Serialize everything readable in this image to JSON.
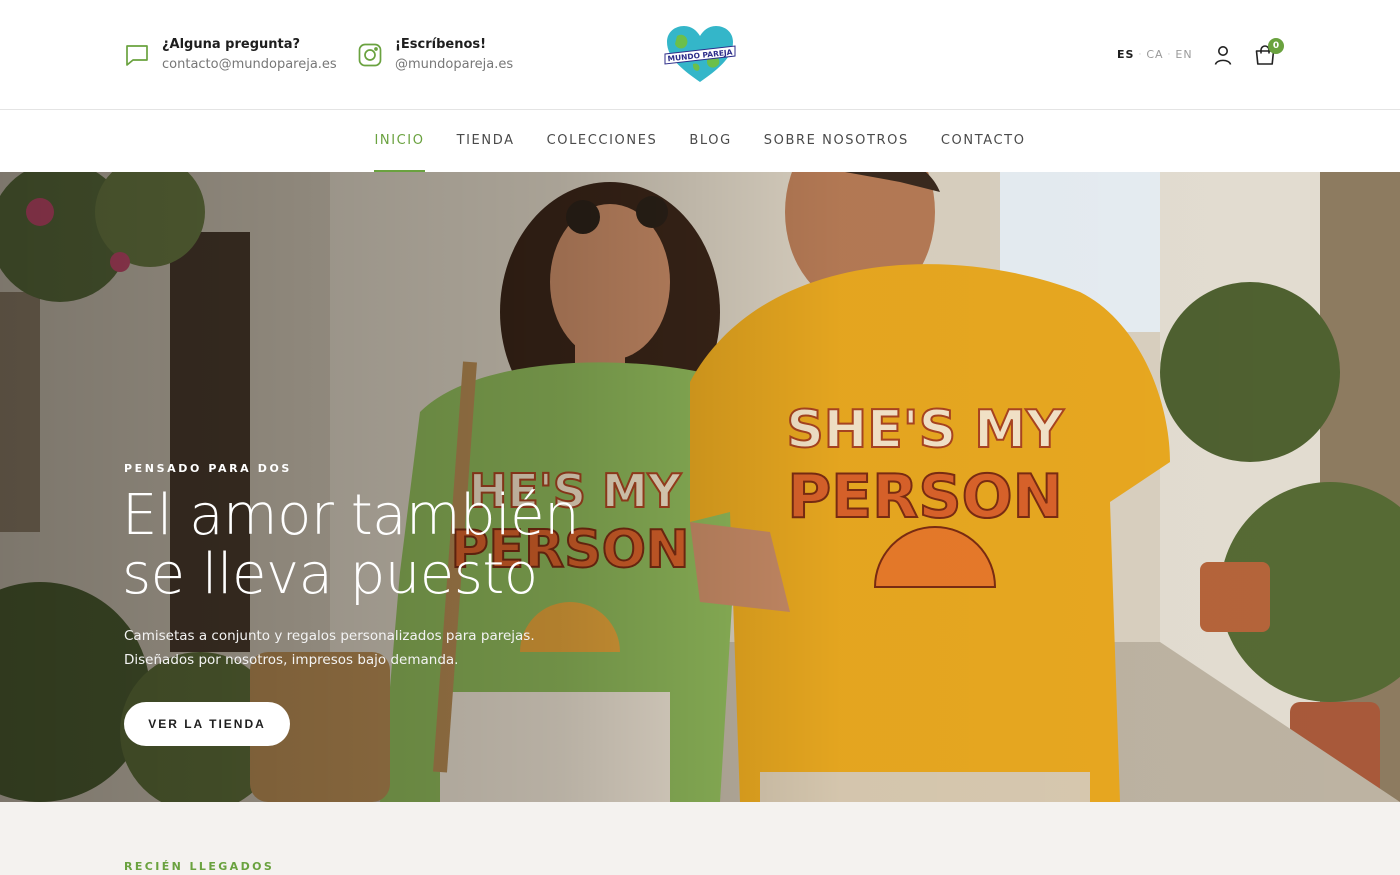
{
  "header": {
    "contact_question": {
      "title": "¿Alguna pregunta?",
      "email": "contacto@mundopareja.es",
      "icon": "chat-bubble-icon"
    },
    "contact_instagram": {
      "title": "¡Escríbenos!",
      "handle": "@mundopareja.es",
      "icon": "instagram-icon"
    },
    "logo_text": "MUNDO PAREJA",
    "languages": [
      {
        "code": "ES",
        "active": true
      },
      {
        "code": "CA",
        "active": false
      },
      {
        "code": "EN",
        "active": false
      }
    ],
    "account_icon": "user-icon",
    "cart": {
      "icon": "shopping-bag-icon",
      "count": "0"
    }
  },
  "nav": {
    "items": [
      {
        "label": "INICIO",
        "active": true
      },
      {
        "label": "TIENDA",
        "active": false
      },
      {
        "label": "COLECCIONES",
        "active": false
      },
      {
        "label": "BLOG",
        "active": false
      },
      {
        "label": "SOBRE NOSOTROS",
        "active": false
      },
      {
        "label": "CONTACTO",
        "active": false
      }
    ]
  },
  "hero": {
    "eyebrow": "PENSADO PARA DOS",
    "title": "El amor también se lleva puesto",
    "text": "Camisetas a conjunto y regalos personalizados para parejas. Diseñados por nosotros, impresos bajo demanda.",
    "button_label": "VER LA TIENDA",
    "shirt_left_text": "HE'S MY PERSON",
    "shirt_right_text": "SHE'S MY PERSON"
  },
  "section": {
    "eyebrow": "RECIÉN LLEGADOS"
  },
  "colors": {
    "accent": "#6aa23f",
    "text_dark": "#1e1e1e",
    "section_bg": "#f4f2ef",
    "shirt_green": "#8fb85a",
    "shirt_yellow": "#e8a820"
  }
}
